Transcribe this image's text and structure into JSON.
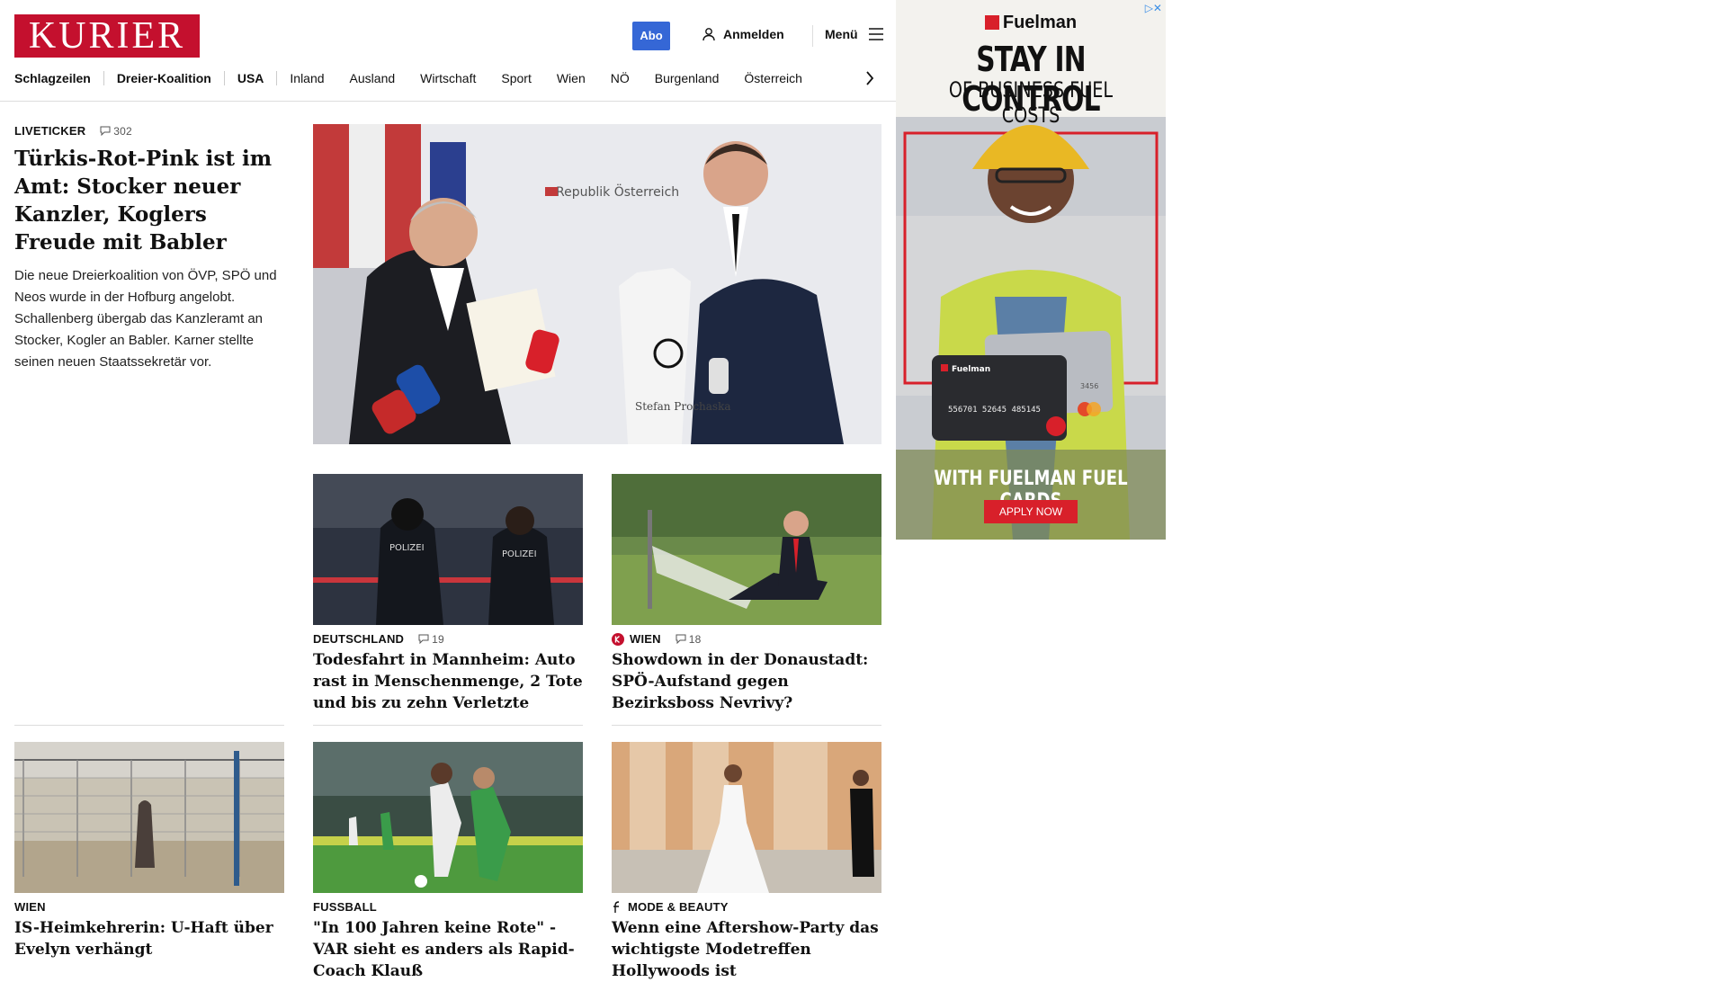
{
  "header": {
    "logo": "KURIER",
    "abo": "Abo",
    "login": "Anmelden",
    "menu": "Menü"
  },
  "nav": [
    "Schlagzeilen",
    "Dreier-Koalition",
    "USA",
    "Inland",
    "Ausland",
    "Wirtschaft",
    "Sport",
    "Wien",
    "NÖ",
    "Burgenland",
    "Österreich"
  ],
  "lead": {
    "kicker": "LIVETICKER",
    "comments": "302",
    "title": "Türkis-Rot-Pink ist im Amt: Stocker neuer Kanzler, Koglers Freude mit Babler",
    "teaser": "Die neue Dreierkoalition von ÖVP, SPÖ und Neos wurde in der Hofburg angelobt. Schallenberg übergab das Kanzleramt an Stocker, Kogler an Babler. Karner stellte seinen neuen Staatssekretär vor.",
    "hero_sign": "Republik Österreich",
    "shirt_name": "Stefan Prochaska"
  },
  "cards": [
    {
      "kicker": "DEUTSCHLAND",
      "comments": "19",
      "title": "Todesfahrt in Mannheim: Auto rast in Menschenmenge, 2 Tote und bis zu zehn Verletzte",
      "img_text": "POLIZEI"
    },
    {
      "kicker": "WIEN",
      "comments": "18",
      "title": "Showdown in der Donaustadt: SPÖ-Aufstand gegen Bezirksboss Nevrivy?"
    },
    {
      "kicker": "WIEN",
      "title": "IS-Heimkehrerin: U-Haft über Evelyn verhängt"
    },
    {
      "kicker": "FUSSBALL",
      "title": "\"In 100 Jahren keine Rote\" - VAR sieht es anders als Rapid-Coach Klauß"
    },
    {
      "kicker": "MODE & BEAUTY",
      "title": "Wenn eine Aftershow-Party das wichtigste Modetreffen Hollywoods ist"
    }
  ],
  "ad": {
    "brand": "Fuelman",
    "headline": "STAY IN CONTROL",
    "subheadline": "OF BUSINESS FUEL COSTS",
    "card_brand": "Fuelman",
    "card_number": "556701 52645 485145",
    "card_small": "3456",
    "cta": "WITH FUELMAN FUEL CARDS",
    "button": "APPLY NOW"
  },
  "colors": {
    "brand_red": "#c4102e",
    "abo_blue": "#3567d6",
    "ad_red": "#d8202a"
  }
}
